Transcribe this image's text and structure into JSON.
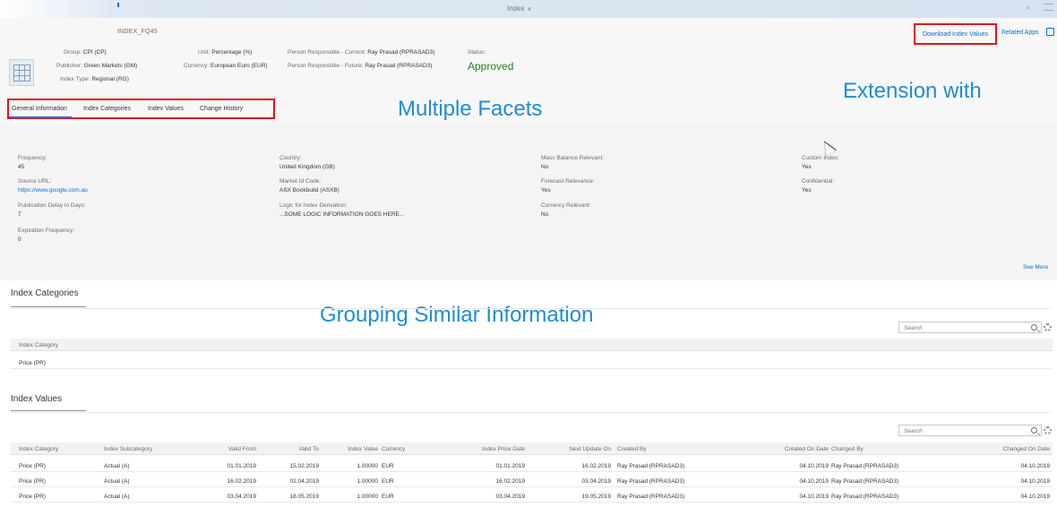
{
  "shell": {
    "title": "Index",
    "chevron": "∨"
  },
  "object": {
    "id": "INDEX_FQ45",
    "group_label": "Group:",
    "group_value": "CPI (CP)",
    "publisher_label": "Publisher:",
    "publisher_value": "Green Markets (GM)",
    "index_type_label": "Index Type:",
    "index_type_value": "Regional (RG)",
    "unit_label": "Unit:",
    "unit_value": "Percentage (%)",
    "currency_label": "Currency:",
    "currency_value": "European Euro (EUR)",
    "person_current_label": "Person Responsible - Current:",
    "person_current_value": "Ray Prasad (RPRASAD3)",
    "person_future_label": "Person Responsible - Future:",
    "person_future_value": "Ray Prasad (RPRASAD3)",
    "status_label": "Status:",
    "status_value": "Approved"
  },
  "actions": {
    "download": "Download Index Values",
    "related": "Related Apps"
  },
  "tabs": [
    {
      "label": "General Information"
    },
    {
      "label": "Index Categories"
    },
    {
      "label": "Index Values"
    },
    {
      "label": "Change History"
    }
  ],
  "annotations": {
    "facets": "Multiple Facets",
    "extension": "Extension with",
    "grouping": "Grouping Similar Information"
  },
  "general": {
    "frequency_label": "Frequency:",
    "frequency_value": "45",
    "source_url_label": "Source URL:",
    "source_url_value": "https://www.google.com.au",
    "publication_delay_label": "Publication Delay in Days:",
    "publication_delay_value": "7",
    "expiration_label": "Expiration Frequency:",
    "expiration_value": "0",
    "country_label": "Country:",
    "country_value": "United Kingdom (GB)",
    "market_label": "Market Id Code:",
    "market_value": "ASX Bookbuild (ASXB)",
    "logic_label": "Logic for Index Derivation:",
    "logic_value": "...SOME LOGIC INFORMATION GOES HERE...",
    "mass_label": "Mass Balance Relevant:",
    "mass_value": "No",
    "forecast_label": "Forecast Relevance:",
    "forecast_value": "Yes",
    "currency_rel_label": "Currency Relevant:",
    "currency_rel_value": "No",
    "custom_label": "Custom Index:",
    "custom_value": "Yes",
    "confidential_label": "Confidential:",
    "confidential_value": "Yes",
    "see_more": "See More"
  },
  "categories_section": {
    "title": "Index Categories",
    "search_placeholder": "Search",
    "header": "Index Category",
    "rows": [
      "Price (PR)"
    ]
  },
  "values_section": {
    "title": "Index Values",
    "search_placeholder": "Search",
    "headers": {
      "category": "Index Category",
      "subcategory": "Index Subcategory",
      "valid_from": "Valid From",
      "valid_to": "Valid To",
      "index_value": "Index Value",
      "currency": "Currency",
      "price_date": "Index Price Date",
      "next_update": "Next Update On",
      "created_by": "Created By",
      "created_on": "Created On Date",
      "changed_by": "Changed By",
      "changed_on": "Changed On Date"
    },
    "rows": [
      {
        "category": "Price (PR)",
        "subcategory": "Actual (A)",
        "valid_from": "01.01.2019",
        "valid_to": "15.02.2019",
        "index_value": "1.00000",
        "currency": "EUR",
        "price_date": "01.01.2019",
        "next_update": "16.02.2019",
        "created_by": "Ray Prasad (RPRASAD3)",
        "created_on": "04.10.2019",
        "changed_by": "Ray Prasad (RPRASAD3)",
        "changed_on": "04.10.2019"
      },
      {
        "category": "Price (PR)",
        "subcategory": "Actual (A)",
        "valid_from": "16.02.2019",
        "valid_to": "02.04.2019",
        "index_value": "1.00000",
        "currency": "EUR",
        "price_date": "16.02.2019",
        "next_update": "03.04.2019",
        "created_by": "Ray Prasad (RPRASAD3)",
        "created_on": "04.10.2019",
        "changed_by": "Ray Prasad (RPRASAD3)",
        "changed_on": "04.10.2019"
      },
      {
        "category": "Price (PR)",
        "subcategory": "Actual (A)",
        "valid_from": "03.04.2019",
        "valid_to": "18.05.2019",
        "index_value": "1.00000",
        "currency": "EUR",
        "price_date": "03.04.2019",
        "next_update": "19.05.2019",
        "created_by": "Ray Prasad (RPRASAD3)",
        "created_on": "04.10.2019",
        "changed_by": "Ray Prasad (RPRASAD3)",
        "changed_on": "04.10.2019"
      }
    ]
  }
}
